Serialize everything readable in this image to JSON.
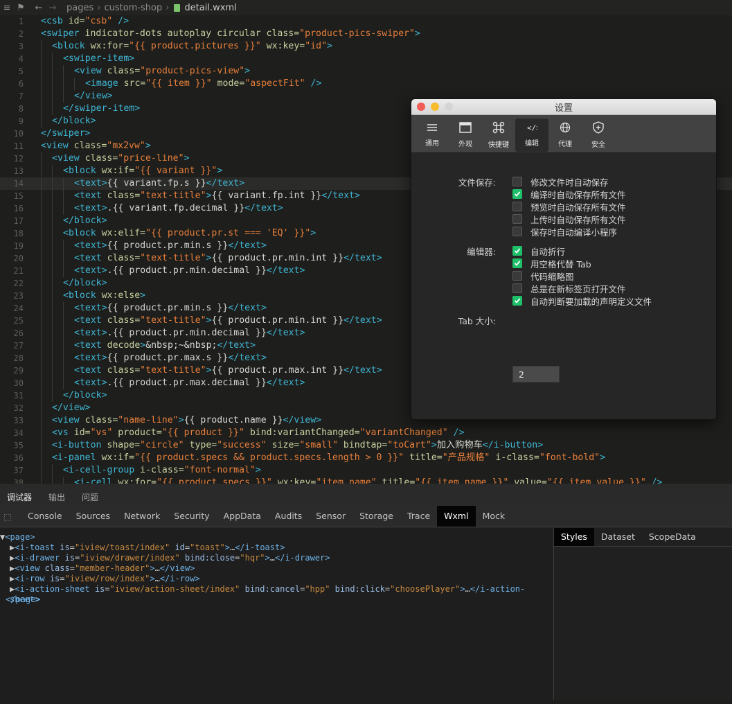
{
  "breadcrumb": [
    "pages",
    "custom-shop",
    "detail.wxml"
  ],
  "editor": {
    "active_line": 14,
    "lines": [
      {
        "n": "1",
        "i": 0,
        "seg": [
          [
            "t",
            "<csb "
          ],
          [
            "a",
            "id="
          ],
          [
            "s",
            "\"csb\""
          ],
          [
            "t",
            " />"
          ]
        ]
      },
      {
        "n": "2",
        "i": 0,
        "seg": [
          [
            "t",
            "<swiper "
          ],
          [
            "a",
            "indicator-dots autoplay circular class="
          ],
          [
            "s",
            "\"product-pics-swiper\""
          ],
          [
            "t",
            ">"
          ]
        ]
      },
      {
        "n": "3",
        "i": 1,
        "seg": [
          [
            "t",
            "<block "
          ],
          [
            "a",
            "wx:for="
          ],
          [
            "s",
            "\"{{ product.pictures }}\""
          ],
          [
            "a",
            " wx:key="
          ],
          [
            "s",
            "\"id\""
          ],
          [
            "t",
            ">"
          ]
        ]
      },
      {
        "n": "4",
        "i": 2,
        "seg": [
          [
            "t",
            "<swiper-item>"
          ]
        ]
      },
      {
        "n": "5",
        "i": 3,
        "seg": [
          [
            "t",
            "<view "
          ],
          [
            "a",
            "class="
          ],
          [
            "s",
            "\"product-pics-view\""
          ],
          [
            "t",
            ">"
          ]
        ]
      },
      {
        "n": "6",
        "i": 4,
        "seg": [
          [
            "t",
            "<image "
          ],
          [
            "a",
            "src="
          ],
          [
            "s",
            "\"{{ item }}\""
          ],
          [
            "a",
            " mode="
          ],
          [
            "s",
            "\"aspectFit\""
          ],
          [
            "t",
            " />"
          ]
        ]
      },
      {
        "n": "7",
        "i": 3,
        "seg": [
          [
            "t",
            "</view>"
          ]
        ]
      },
      {
        "n": "8",
        "i": 2,
        "seg": [
          [
            "t",
            "</swiper-item>"
          ]
        ]
      },
      {
        "n": "9",
        "i": 1,
        "seg": [
          [
            "t",
            "</block>"
          ]
        ]
      },
      {
        "n": "10",
        "i": 0,
        "seg": [
          [
            "t",
            "</swiper>"
          ]
        ]
      },
      {
        "n": "11",
        "i": 0,
        "seg": [
          [
            "t",
            "<view "
          ],
          [
            "a",
            "class="
          ],
          [
            "s",
            "\"mx2vw\""
          ],
          [
            "t",
            ">"
          ]
        ]
      },
      {
        "n": "12",
        "i": 1,
        "seg": [
          [
            "t",
            "<view "
          ],
          [
            "a",
            "class="
          ],
          [
            "s",
            "\"price-line\""
          ],
          [
            "t",
            ">"
          ]
        ]
      },
      {
        "n": "13",
        "i": 2,
        "seg": [
          [
            "t",
            "<block "
          ],
          [
            "a",
            "wx:if="
          ],
          [
            "s",
            "\"{{ variant }}\""
          ],
          [
            "t",
            ">"
          ]
        ]
      },
      {
        "n": "14",
        "i": 3,
        "seg": [
          [
            "t",
            "<text>"
          ],
          [
            "e",
            "{{ variant.fp.s }}"
          ],
          [
            "t",
            "</text>"
          ]
        ]
      },
      {
        "n": "15",
        "i": 3,
        "seg": [
          [
            "t",
            "<text "
          ],
          [
            "a",
            "class="
          ],
          [
            "s",
            "\"text-title\""
          ],
          [
            "t",
            ">"
          ],
          [
            "e",
            "{{ variant.fp.int }}"
          ],
          [
            "t",
            "</text>"
          ]
        ]
      },
      {
        "n": "16",
        "i": 3,
        "seg": [
          [
            "t",
            "<text>"
          ],
          [
            "e",
            ".{{ variant.fp.decimal }}"
          ],
          [
            "t",
            "</text>"
          ]
        ]
      },
      {
        "n": "17",
        "i": 2,
        "seg": [
          [
            "t",
            "</block>"
          ]
        ]
      },
      {
        "n": "18",
        "i": 2,
        "seg": [
          [
            "t",
            "<block "
          ],
          [
            "a",
            "wx:elif="
          ],
          [
            "s",
            "\"{{ product.pr.st === 'EQ' }}\""
          ],
          [
            "t",
            ">"
          ]
        ]
      },
      {
        "n": "19",
        "i": 3,
        "seg": [
          [
            "t",
            "<text>"
          ],
          [
            "e",
            "{{ product.pr.min.s }}"
          ],
          [
            "t",
            "</text>"
          ]
        ]
      },
      {
        "n": "20",
        "i": 3,
        "seg": [
          [
            "t",
            "<text "
          ],
          [
            "a",
            "class="
          ],
          [
            "s",
            "\"text-title\""
          ],
          [
            "t",
            ">"
          ],
          [
            "e",
            "{{ product.pr.min.int }}"
          ],
          [
            "t",
            "</text>"
          ]
        ]
      },
      {
        "n": "21",
        "i": 3,
        "seg": [
          [
            "t",
            "<text>"
          ],
          [
            "e",
            ".{{ product.pr.min.decimal }}"
          ],
          [
            "t",
            "</text>"
          ]
        ]
      },
      {
        "n": "22",
        "i": 2,
        "seg": [
          [
            "t",
            "</block>"
          ]
        ]
      },
      {
        "n": "23",
        "i": 2,
        "seg": [
          [
            "t",
            "<block "
          ],
          [
            "a",
            "wx:else"
          ],
          [
            "t",
            ">"
          ]
        ]
      },
      {
        "n": "24",
        "i": 3,
        "seg": [
          [
            "t",
            "<text>"
          ],
          [
            "e",
            "{{ product.pr.min.s }}"
          ],
          [
            "t",
            "</text>"
          ]
        ]
      },
      {
        "n": "25",
        "i": 3,
        "seg": [
          [
            "t",
            "<text "
          ],
          [
            "a",
            "class="
          ],
          [
            "s",
            "\"text-title\""
          ],
          [
            "t",
            ">"
          ],
          [
            "e",
            "{{ product.pr.min.int }}"
          ],
          [
            "t",
            "</text>"
          ]
        ]
      },
      {
        "n": "26",
        "i": 3,
        "seg": [
          [
            "t",
            "<text>"
          ],
          [
            "e",
            ".{{ product.pr.min.decimal }}"
          ],
          [
            "t",
            "</text>"
          ]
        ]
      },
      {
        "n": "27",
        "i": 3,
        "seg": [
          [
            "t",
            "<text "
          ],
          [
            "a",
            "decode"
          ],
          [
            "t",
            ">"
          ],
          [
            "e",
            "&nbsp;~&nbsp;"
          ],
          [
            "t",
            "</text>"
          ]
        ]
      },
      {
        "n": "28",
        "i": 3,
        "seg": [
          [
            "t",
            "<text>"
          ],
          [
            "e",
            "{{ product.pr.max.s }}"
          ],
          [
            "t",
            "</text>"
          ]
        ]
      },
      {
        "n": "29",
        "i": 3,
        "seg": [
          [
            "t",
            "<text "
          ],
          [
            "a",
            "class="
          ],
          [
            "s",
            "\"text-title\""
          ],
          [
            "t",
            ">"
          ],
          [
            "e",
            "{{ product.pr.max.int }}"
          ],
          [
            "t",
            "</text>"
          ]
        ]
      },
      {
        "n": "30",
        "i": 3,
        "seg": [
          [
            "t",
            "<text>"
          ],
          [
            "e",
            ".{{ product.pr.max.decimal }}"
          ],
          [
            "t",
            "</text>"
          ]
        ]
      },
      {
        "n": "31",
        "i": 2,
        "seg": [
          [
            "t",
            "</block>"
          ]
        ]
      },
      {
        "n": "32",
        "i": 1,
        "seg": [
          [
            "t",
            "</view>"
          ]
        ]
      },
      {
        "n": "33",
        "i": 1,
        "seg": [
          [
            "t",
            "<view "
          ],
          [
            "a",
            "class="
          ],
          [
            "s",
            "\"name-line\""
          ],
          [
            "t",
            ">"
          ],
          [
            "e",
            "{{ product.name }}"
          ],
          [
            "t",
            "</view>"
          ]
        ]
      },
      {
        "n": "34",
        "i": 1,
        "seg": [
          [
            "t",
            "<vs "
          ],
          [
            "a",
            "id="
          ],
          [
            "s",
            "\"vs\""
          ],
          [
            "a",
            " product="
          ],
          [
            "s",
            "\"{{ product }}\""
          ],
          [
            "a",
            " bind:variantChanged="
          ],
          [
            "s",
            "\"variantChanged\""
          ],
          [
            "t",
            " />"
          ]
        ]
      },
      {
        "n": "35",
        "i": 1,
        "seg": [
          [
            "t",
            "<i-button "
          ],
          [
            "a",
            "shape="
          ],
          [
            "s",
            "\"circle\""
          ],
          [
            "a",
            " type="
          ],
          [
            "s",
            "\"success\""
          ],
          [
            "a",
            " size="
          ],
          [
            "s",
            "\"small\""
          ],
          [
            "a",
            " bindtap="
          ],
          [
            "s",
            "\"toCart\""
          ],
          [
            "t",
            ">"
          ],
          [
            "e",
            "加入购物车"
          ],
          [
            "t",
            "</i-button>"
          ]
        ]
      },
      {
        "n": "36",
        "i": 1,
        "seg": [
          [
            "t",
            "<i-panel "
          ],
          [
            "a",
            "wx:if="
          ],
          [
            "s",
            "\"{{ product.specs && product.specs.length > 0 }}\""
          ],
          [
            "a",
            " title="
          ],
          [
            "s",
            "\"产品规格\""
          ],
          [
            "a",
            " i-class="
          ],
          [
            "s",
            "\"font-bold\""
          ],
          [
            "t",
            ">"
          ]
        ]
      },
      {
        "n": "37",
        "i": 2,
        "seg": [
          [
            "t",
            "<i-cell-group "
          ],
          [
            "a",
            "i-class="
          ],
          [
            "s",
            "\"font-normal\""
          ],
          [
            "t",
            ">"
          ]
        ]
      },
      {
        "n": "38",
        "i": 3,
        "seg": [
          [
            "t",
            "<i-cell "
          ],
          [
            "a",
            "wx:for="
          ],
          [
            "s",
            "\"{{ product.specs }}\""
          ],
          [
            "a",
            " wx:key="
          ],
          [
            "s",
            "\"item.name\""
          ],
          [
            "a",
            " title="
          ],
          [
            "s",
            "\"{{ item.name }}\""
          ],
          [
            "a",
            " value="
          ],
          [
            "s",
            "\"{{ item.value }}\""
          ],
          [
            "t",
            " />"
          ]
        ]
      }
    ]
  },
  "panel": {
    "top_tabs": [
      "调试器",
      "输出",
      "问题"
    ],
    "dev_tabs": [
      "Console",
      "Sources",
      "Network",
      "Security",
      "AppData",
      "Audits",
      "Sensor",
      "Storage",
      "Trace",
      "Wxml",
      "Mock"
    ],
    "active_dev_tab": "Wxml",
    "side_tabs": [
      "Styles",
      "Dataset",
      "ScopeData"
    ],
    "dom": {
      "root_open": "<page>",
      "root_close": "</page>",
      "children": [
        {
          "tag": "i-toast",
          "attrs": [
            [
              "is",
              "\"iview/toast/index\""
            ],
            [
              "id",
              "\"toast\""
            ]
          ]
        },
        {
          "tag": "i-drawer",
          "attrs": [
            [
              "is",
              "\"iview/drawer/index\""
            ],
            [
              "bind:close",
              "\"hqr\""
            ]
          ]
        },
        {
          "tag": "view",
          "attrs": [
            [
              "class",
              "\"member-header\""
            ]
          ]
        },
        {
          "tag": "i-row",
          "attrs": [
            [
              "is",
              "\"iview/row/index\""
            ]
          ]
        },
        {
          "tag": "i-action-sheet",
          "attrs": [
            [
              "is",
              "\"iview/action-sheet/index\""
            ],
            [
              "bind:cancel",
              "\"hpp\""
            ],
            [
              "bind:click",
              "\"choosePlayer\""
            ]
          ]
        }
      ]
    }
  },
  "settings": {
    "title": "设置",
    "toolbar": [
      {
        "label": "通用",
        "icon": "list-icon"
      },
      {
        "label": "外观",
        "icon": "window-icon"
      },
      {
        "label": "快捷键",
        "icon": "command-icon"
      },
      {
        "label": "编辑",
        "icon": "code-icon"
      },
      {
        "label": "代理",
        "icon": "globe-icon"
      },
      {
        "label": "安全",
        "icon": "shield-icon"
      }
    ],
    "active_tab": "编辑",
    "file_save_label": "文件保存:",
    "file_save_options": [
      {
        "label": "修改文件时自动保存",
        "checked": false
      },
      {
        "label": "编译时自动保存所有文件",
        "checked": true
      },
      {
        "label": "预览时自动保存所有文件",
        "checked": false
      },
      {
        "label": "上传时自动保存所有文件",
        "checked": false
      },
      {
        "label": "保存时自动编译小程序",
        "checked": false
      }
    ],
    "editor_label": "编辑器:",
    "editor_options": [
      {
        "label": "自动折行",
        "checked": true
      },
      {
        "label": "用空格代替 Tab",
        "checked": true
      },
      {
        "label": "代码缩略图",
        "checked": false
      },
      {
        "label": "总是在新标签页打开文件",
        "checked": false
      },
      {
        "label": "自动判断要加载的声明定义文件",
        "checked": true
      }
    ],
    "tab_size_label": "Tab 大小:",
    "tab_size_value": "2",
    "accent_color": "#1fc06a"
  }
}
